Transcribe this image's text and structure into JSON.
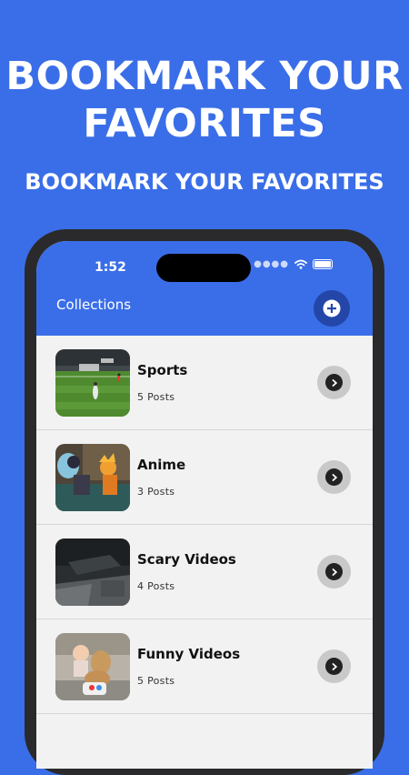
{
  "promo": {
    "headline": "BOOKMARK YOUR FAVORITES",
    "subheadline": "BOOKMARK YOUR FAVORITES"
  },
  "status_bar": {
    "time": "1:52",
    "signal_icon": "signal-dots-icon",
    "wifi_icon": "wifi-icon",
    "battery_icon": "battery-icon"
  },
  "header": {
    "title": "Collections",
    "add_icon": "plus-circle-icon"
  },
  "collections": [
    {
      "title": "Sports",
      "count": "5 Posts",
      "thumbnail": "soccer-field-thumbnail"
    },
    {
      "title": "Anime",
      "count": "3 Posts",
      "thumbnail": "anime-characters-thumbnail"
    },
    {
      "title": "Scary Videos",
      "count": "4 Posts",
      "thumbnail": "dark-room-thumbnail"
    },
    {
      "title": "Funny Videos",
      "count": "5 Posts",
      "thumbnail": "dog-and-baby-thumbnail"
    }
  ],
  "colors": {
    "brand_blue": "#3a6ee8",
    "add_button": "#2346a8",
    "list_background": "#f2f2f2",
    "chevron_button": "#c9c9c9"
  }
}
